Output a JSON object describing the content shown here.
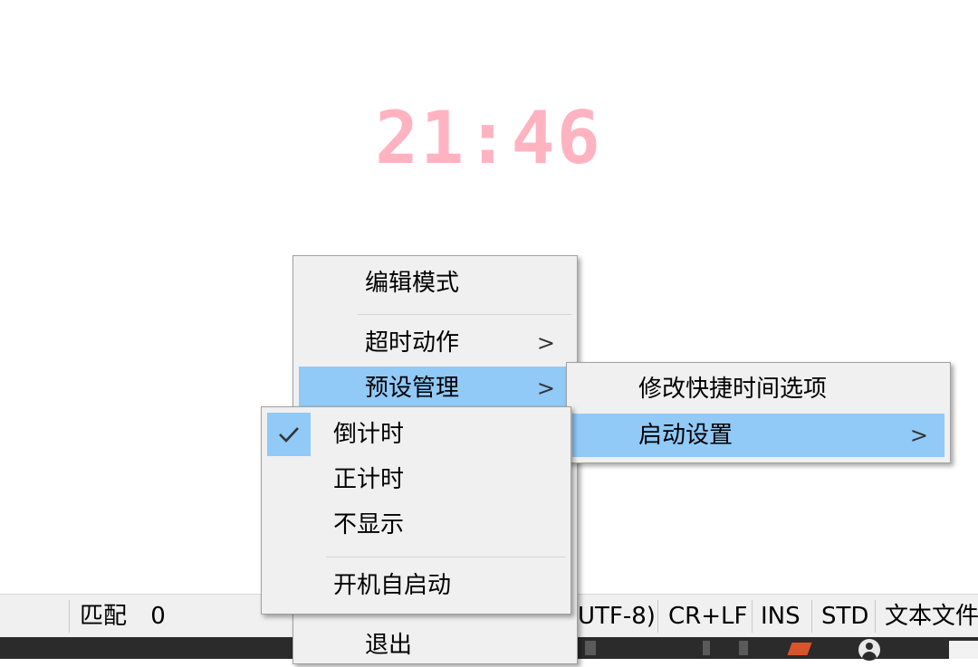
{
  "clock": {
    "time": "21:46"
  },
  "statusbar": {
    "match_label": "匹配",
    "match_count": "0",
    "encoding": "UTF-8)",
    "line_ending": "CR+LF",
    "insert_mode": "INS",
    "std_mode": "STD",
    "file_type": "文本文件"
  },
  "context_menu": {
    "items": [
      {
        "label": "编辑模式"
      },
      {
        "label": "超时动作",
        "arrow": ">"
      },
      {
        "label": "预设管理",
        "arrow": ">"
      },
      {
        "label": "退出"
      }
    ]
  },
  "preset_submenu": {
    "items": [
      {
        "label": "修改快捷时间选项"
      },
      {
        "label": "启动设置",
        "arrow": ">"
      }
    ]
  },
  "startup_submenu": {
    "items": [
      {
        "label": "倒计时",
        "checked": true
      },
      {
        "label": "正计时",
        "checked": false
      },
      {
        "label": "不显示",
        "checked": false
      },
      {
        "label": "开机自启动",
        "checked": false
      }
    ]
  },
  "colors": {
    "clock": "#ffb3c1",
    "menu_bg": "#f0f0f0",
    "highlight": "#91c9f7",
    "taskbar": "#2b2b2b"
  }
}
